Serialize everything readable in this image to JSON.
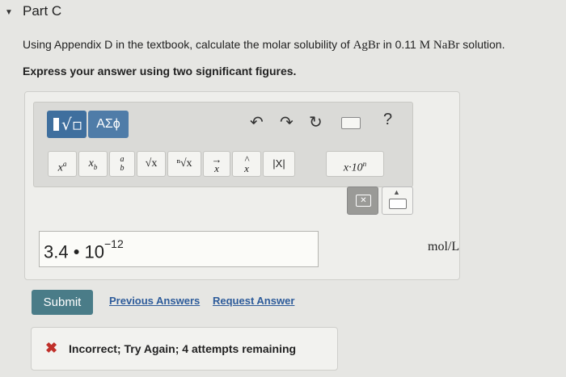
{
  "part": {
    "toggle_icon": "triangle-down-icon",
    "title": "Part C"
  },
  "question": {
    "prefix": "Using Appendix D in the textbook, calculate the molar solubility of ",
    "compound": "AgBr",
    "middle": " in 0.11 ",
    "unit": "M",
    "space": " ",
    "solvent": "NaBr",
    "suffix": " solution."
  },
  "instruction": "Express your answer using two significant figures.",
  "toolbar": {
    "greek_label": "ΑΣϕ",
    "undo_icon": "↶",
    "redo_icon": "↷",
    "reset_icon": "↻",
    "help_label": "?"
  },
  "math_buttons": {
    "superscript": {
      "base": "x",
      "sup": "a"
    },
    "subscript": {
      "base": "x",
      "sub": "b"
    },
    "fraction": {
      "num": "a",
      "den": "b"
    },
    "sqrt": "√x",
    "nthroot": "ⁿ√x",
    "vector": {
      "arrow": "→",
      "base": "x"
    },
    "unit_vector": {
      "hat": "^",
      "base": "x"
    },
    "abs": "|X|",
    "scientific": {
      "label": "x·10",
      "sup": "n"
    }
  },
  "answer": {
    "value": "3.4 • 10",
    "exponent": "−12",
    "units": "mol/L"
  },
  "actions": {
    "submit_label": "Submit",
    "previous_answers_label": "Previous Answers",
    "request_answer_label": "Request Answer"
  },
  "feedback": {
    "icon": "✖",
    "message": "Incorrect; Try Again; 4 attempts remaining"
  },
  "colors": {
    "submit": "#4a7c88",
    "template_button": "#3f6f9e",
    "error": "#c0302a",
    "link": "#2d5b9a"
  }
}
